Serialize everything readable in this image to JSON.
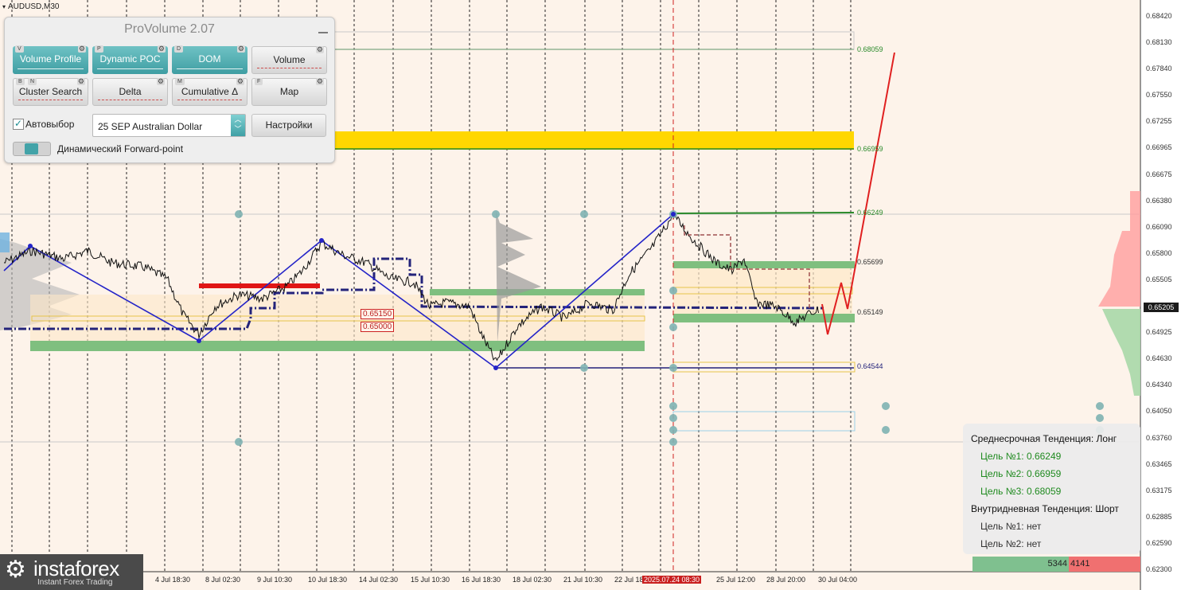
{
  "symbol": "AUDUSD,M30",
  "panel": {
    "title": "ProVolume 2.07",
    "buttons": [
      {
        "label": "Volume Profile",
        "hotkey": "V",
        "active": true
      },
      {
        "label": "Dynamic POC",
        "hotkey": "P",
        "active": true
      },
      {
        "label": "DOM",
        "hotkey": "D",
        "active": true
      },
      {
        "label": "Volume",
        "hotkey": "",
        "active": false
      },
      {
        "label": "Cluster Search",
        "hotkey": "B",
        "hotkey2": "N",
        "active": false
      },
      {
        "label": "Delta",
        "hotkey": "",
        "active": false
      },
      {
        "label": "Cumulative Δ",
        "hotkey": "M",
        "active": false
      },
      {
        "label": "Map",
        "hotkey": "F",
        "active": false
      }
    ],
    "auto_select_label": "Автовыбор",
    "auto_select_checked": true,
    "instrument": "25 SEP Australian Dollar",
    "settings_label": "Настройки",
    "forward_point_label": "Динамический Forward-point"
  },
  "y_axis": {
    "ticks": [
      "0.68420",
      "0.68130",
      "0.67840",
      "0.67550",
      "0.67255",
      "0.66965",
      "0.66675",
      "0.66380",
      "0.66090",
      "0.65800",
      "0.65505",
      "0.65215",
      "0.64925",
      "0.64630",
      "0.64340",
      "0.64050",
      "0.63760",
      "0.63465",
      "0.63175",
      "0.62885",
      "0.62590",
      "0.62300"
    ],
    "current_price": "0.65205"
  },
  "x_axis": {
    "ticks": [
      "4 Jul 18:30",
      "8 Jul 02:30",
      "9 Jul 10:30",
      "10 Jul 18:30",
      "14 Jul 02:30",
      "15 Jul 10:30",
      "16 Jul 18:30",
      "18 Jul 02:30",
      "21 Jul 10:30",
      "22 Jul 18:30",
      "2025.07.24 08:30",
      "25 Jul 12:00",
      "28 Jul 20:00",
      "30 Jul 04:00"
    ],
    "highlighted": "2025.07.24 08:30"
  },
  "levels": [
    {
      "label": "0.68059",
      "color": "#2a8a2a"
    },
    {
      "label": "0.66959",
      "color": "#2a8a2a"
    },
    {
      "label": "0.66249",
      "color": "#2a8a2a"
    },
    {
      "label": "0.65699",
      "color": "#333333"
    },
    {
      "label": "0.65149",
      "color": "#333333"
    },
    {
      "label": "0.64544",
      "color": "#23237a"
    }
  ],
  "chart_labels": [
    "0.65150",
    "0.65000"
  ],
  "info": {
    "medium_trend": "Среднесрочная Тенденция: Лонг",
    "targets_long": [
      "Цель №1: 0.66249",
      "Цель №2: 0.66959",
      "Цель №3: 0.68059"
    ],
    "intraday_trend": "Внутридневная Тенденция: Шорт",
    "targets_short": [
      "Цель №1: нет",
      "Цель №2: нет"
    ]
  },
  "volume_bar": {
    "buy": "5344",
    "sell": "4141"
  },
  "logo": {
    "name": "instaforex",
    "tagline": "Instant Forex Trading"
  },
  "colors": {
    "green_zone": "#7fbf7f",
    "yellow_zone": "#ffd700",
    "trend_line": "#2424c8",
    "poc_line": "#23237a",
    "forecast": "#e02020"
  }
}
